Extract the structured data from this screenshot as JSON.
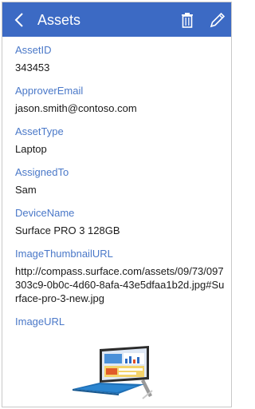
{
  "header": {
    "title": "Assets",
    "back_icon": "chevron-left-icon",
    "delete_icon": "trash-icon",
    "edit_icon": "pencil-icon",
    "background_color": "#3c6ac4"
  },
  "fields": [
    {
      "label": "AssetID",
      "value": "343453"
    },
    {
      "label": "ApproverEmail",
      "value": "jason.smith@contoso.com"
    },
    {
      "label": "AssetType",
      "value": "Laptop"
    },
    {
      "label": "AssignedTo",
      "value": "Sam"
    },
    {
      "label": "DeviceName",
      "value": "Surface PRO 3 128GB"
    },
    {
      "label": "ImageThumbnailURL",
      "value": "http://compass.surface.com/assets/09/73/097303c9-0b0c-4d60-8afa-43e5dfaa1b2d.jpg#Surface-pro-3-new.jpg"
    },
    {
      "label": "ImageURL",
      "value": ""
    }
  ],
  "colors": {
    "label": "#4a78c8",
    "value": "#1a1a1a"
  }
}
